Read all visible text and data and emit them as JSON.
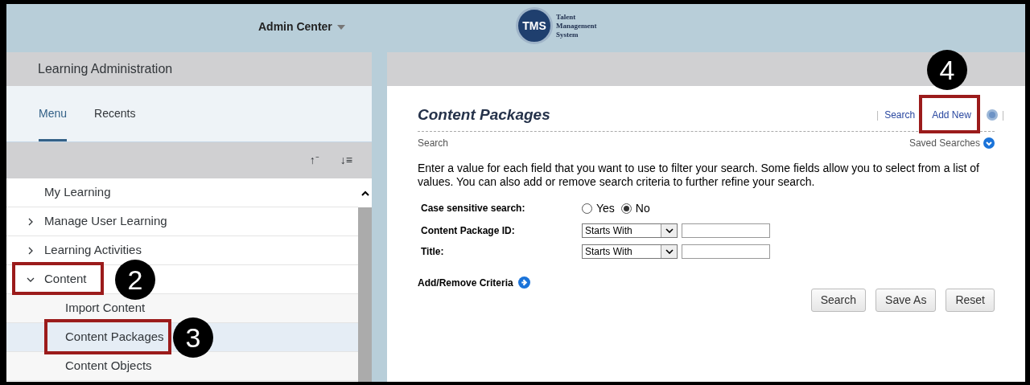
{
  "header": {
    "menu_title": "Admin Center",
    "logo_text": "TMS",
    "logo_caption": [
      "Talent",
      "Management",
      "System"
    ]
  },
  "left_panel": {
    "title": "Learning Administration",
    "tabs": [
      {
        "label": "Menu",
        "selected": true
      },
      {
        "label": "Recents",
        "selected": false
      }
    ],
    "toolbar_icons": [
      "↑⁻",
      "↓≡"
    ],
    "menu": [
      {
        "label": "My Learning",
        "selected": false
      },
      {
        "label": "Manage User Learning",
        "expanded": false,
        "selected": false
      },
      {
        "label": "Learning Activities",
        "expanded": false,
        "selected": false
      },
      {
        "label": "Content",
        "expanded": true,
        "selected": false,
        "children": [
          {
            "label": "Import Content",
            "selected": false
          },
          {
            "label": "Content Packages",
            "selected": true
          },
          {
            "label": "Content Objects",
            "selected": false
          }
        ]
      }
    ]
  },
  "main": {
    "title": "Content Packages",
    "separator": "|",
    "links": [
      "Search",
      "Add New"
    ],
    "subtitle": "Search",
    "saved_searches": "Saved Searches",
    "instructions": "Enter a value for each field that you want to use to filter your search. Some fields allow you to select from a list of values. You can also add or remove search criteria to further refine your search.",
    "case_sensitive": {
      "label": "Case sensitive search:",
      "options": [
        {
          "label": "Yes",
          "selected": false
        },
        {
          "label": "No",
          "selected": true
        }
      ]
    },
    "fields": [
      {
        "label": "Content Package ID:",
        "operator": "Starts With"
      },
      {
        "label": "Title:",
        "operator": "Starts With"
      }
    ],
    "add_remove": "Add/Remove Criteria",
    "buttons": [
      "Search",
      "Save As",
      "Reset"
    ]
  },
  "callouts": [
    {
      "label": "2"
    },
    {
      "label": "3"
    },
    {
      "label": "4"
    }
  ]
}
